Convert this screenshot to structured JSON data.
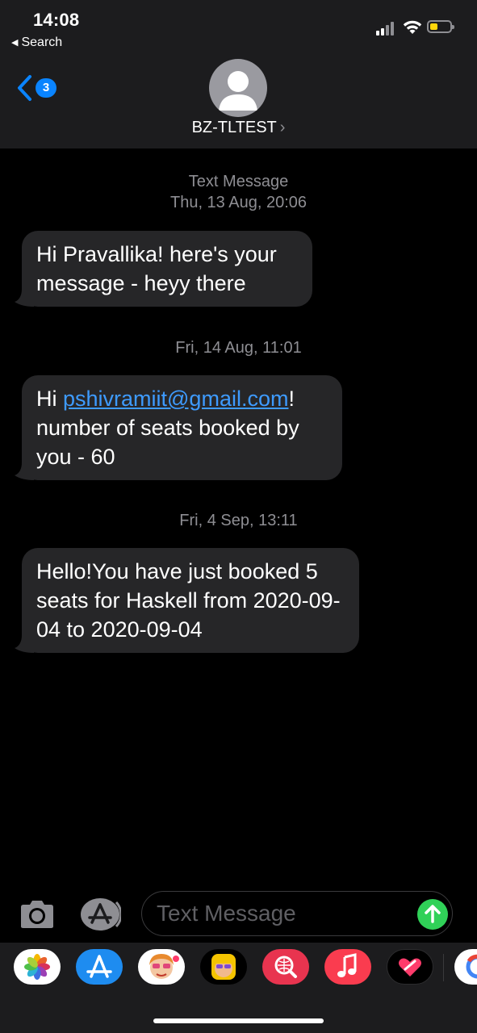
{
  "status_bar": {
    "time": "14:08",
    "back_app_label": "Search",
    "battery_color": "#ffd60a"
  },
  "nav": {
    "back_badge_count": "3",
    "contact_name": "BZ-TLTEST",
    "contact_chevron": "›",
    "accent_color": "#0a84ff"
  },
  "conversation": {
    "service_label": "Text Message",
    "messages": [
      {
        "timestamp": "Thu, 13 Aug, 20:06",
        "text": "Hi Pravallika! here's your message - heyy there"
      },
      {
        "timestamp": "Fri, 14 Aug, 11:01",
        "text_prefix": "Hi ",
        "link": "pshivramiit@gmail.com",
        "text_suffix": "! number of seats booked by you - 60"
      },
      {
        "timestamp": "Fri, 4 Sep, 13:11",
        "text": "Hello!You have just booked 5 seats for Haskell from 2020-09-04 to 2020-09-04"
      }
    ]
  },
  "composer": {
    "placeholder": "Text Message",
    "camera_icon": "camera-icon",
    "apps_icon": "app-store-icon",
    "send_icon": "send-arrow-icon",
    "send_color": "#30d158"
  },
  "app_drawer": {
    "apps": [
      {
        "icon": "photos-app-icon"
      },
      {
        "icon": "app-store-app-icon"
      },
      {
        "icon": "memoji-stickers-icon"
      },
      {
        "icon": "animoji-icon"
      },
      {
        "icon": "web-search-images-icon"
      },
      {
        "icon": "music-app-icon"
      },
      {
        "icon": "digital-touch-icon"
      },
      {
        "icon": "google-app-icon"
      }
    ]
  }
}
